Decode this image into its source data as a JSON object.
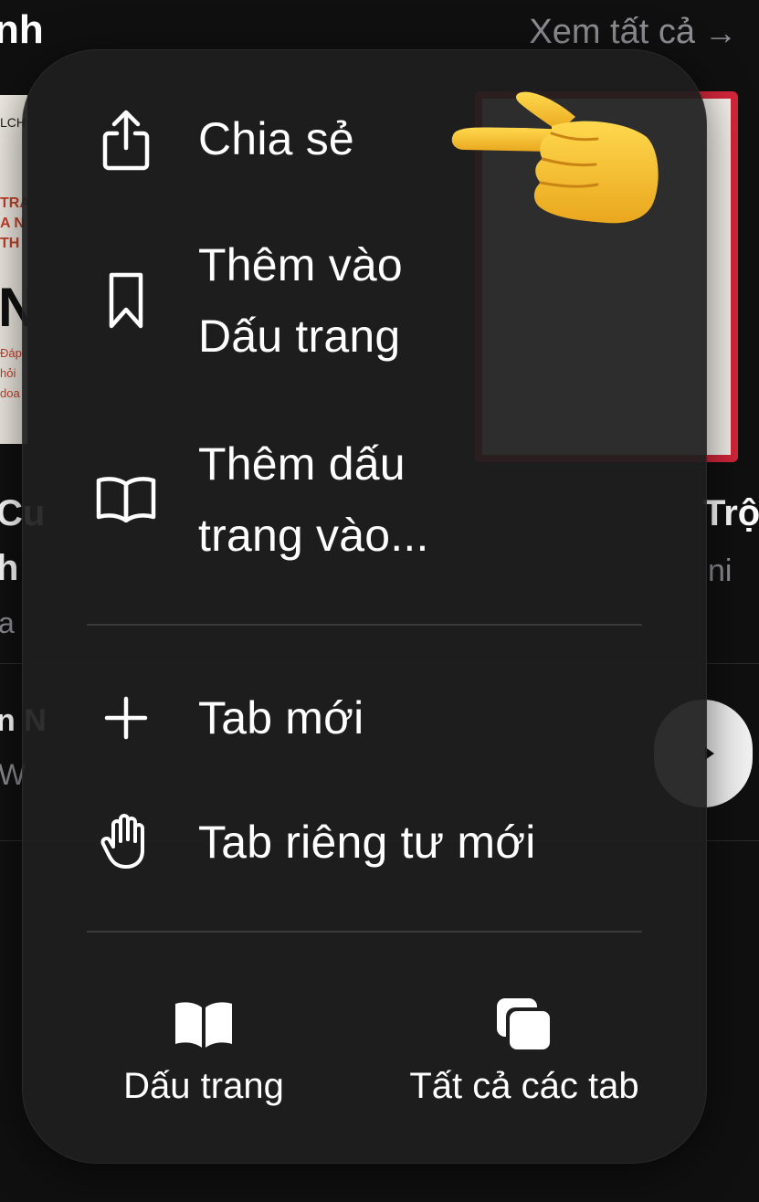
{
  "background": {
    "section_title": "nh",
    "see_all": "Xem tất cả",
    "arrow": "→",
    "left_book_text": {
      "line1": "LCH",
      "red": "TRA\nA N\nTH",
      "big": "N",
      "small": "Đáp\nhỏi\ndoa"
    },
    "left_title_1": "Cu",
    "left_title_2": "h",
    "left_sub_1": "a",
    "left_item_2": "n N",
    "left_item_2_sub": "W",
    "right_title": "Trộ",
    "right_sub": "ni"
  },
  "menu": {
    "items": [
      {
        "label": "Chia sẻ",
        "icon": "share-icon"
      },
      {
        "label": "Thêm vào\nDấu trang",
        "icon": "bookmark-icon"
      },
      {
        "label": "Thêm dấu\ntrang vào...",
        "icon": "open-book-icon"
      },
      {
        "label": "Tab mới",
        "icon": "plus-icon"
      },
      {
        "label": "Tab riêng tư mới",
        "icon": "hand-icon"
      }
    ],
    "bottom": [
      {
        "label": "Dấu trang",
        "icon": "bookmarks-book-icon"
      },
      {
        "label": "Tất cả các tab",
        "icon": "tabs-icon"
      }
    ]
  },
  "colors": {
    "menu_bg": "#1e1e1f",
    "text": "#ffffff",
    "separator": "#3a3a3c",
    "pointer": "#f5c330"
  }
}
